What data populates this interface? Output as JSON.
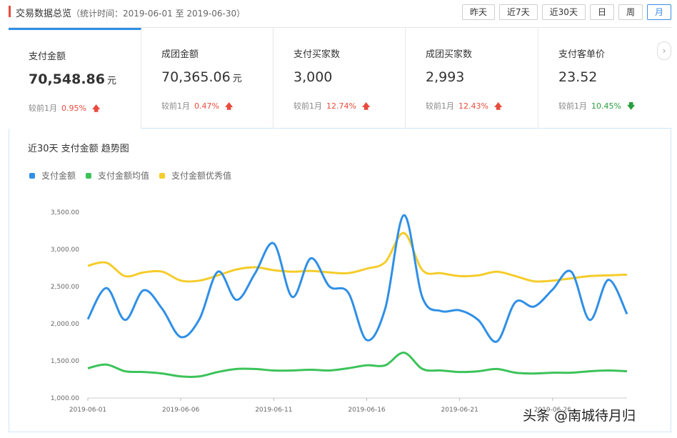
{
  "header": {
    "title": "交易数据总览",
    "subtitle": "（统计时间：2019-06-01 至 2019-06-30）",
    "ranges": [
      "昨天",
      "近7天",
      "近30天",
      "日",
      "周",
      "月"
    ],
    "active_range": "月"
  },
  "metrics": [
    {
      "label": "支付金额",
      "value": "70,548.86",
      "unit": "元",
      "cmp_label": "较前1月",
      "pct": "0.95%",
      "dir": "up"
    },
    {
      "label": "成团金额",
      "value": "70,365.06",
      "unit": "元",
      "cmp_label": "较前1月",
      "pct": "0.47%",
      "dir": "up"
    },
    {
      "label": "支付买家数",
      "value": "3,000",
      "unit": "",
      "cmp_label": "较前1月",
      "pct": "12.74%",
      "dir": "up"
    },
    {
      "label": "成团买家数",
      "value": "2,993",
      "unit": "",
      "cmp_label": "较前1月",
      "pct": "12.43%",
      "dir": "up"
    },
    {
      "label": "支付客单价",
      "value": "23.52",
      "unit": "",
      "cmp_label": "较前1月",
      "pct": "10.45%",
      "dir": "down"
    }
  ],
  "arrows": {
    "up": "🡅",
    "down": "🡇"
  },
  "next_icon": "›",
  "chart_title": "近30天 支付金额 趋势图",
  "watermark": "头条 @南城待月归",
  "colors": {
    "blue": "#2f8fe6",
    "green": "#3cc35a",
    "yellow": "#f5cc2a",
    "accent": "#e84c3d"
  },
  "chart_data": {
    "type": "line",
    "title": "近30天 支付金额 趋势图",
    "legend_position": "top-left",
    "grid": false,
    "ylim": [
      1000,
      3500
    ],
    "y_ticks": [
      "1,000.00",
      "1,500.00",
      "2,000.00",
      "2,500.00",
      "3,000.00",
      "3,500.00"
    ],
    "y_tick_values": [
      1000,
      1500,
      2000,
      2500,
      3000,
      3500
    ],
    "x_tick_labels": [
      "2019-06-01",
      "2019-06-06",
      "2019-06-11",
      "2019-06-16",
      "2019-06-21",
      "2019-06-26"
    ],
    "x": [
      "2019-06-01",
      "2019-06-02",
      "2019-06-03",
      "2019-06-04",
      "2019-06-05",
      "2019-06-06",
      "2019-06-07",
      "2019-06-08",
      "2019-06-09",
      "2019-06-10",
      "2019-06-11",
      "2019-06-12",
      "2019-06-13",
      "2019-06-14",
      "2019-06-15",
      "2019-06-16",
      "2019-06-17",
      "2019-06-18",
      "2019-06-19",
      "2019-06-20",
      "2019-06-21",
      "2019-06-22",
      "2019-06-23",
      "2019-06-24",
      "2019-06-25",
      "2019-06-26",
      "2019-06-27",
      "2019-06-28",
      "2019-06-29",
      "2019-06-30"
    ],
    "series": [
      {
        "name": "支付金额",
        "color": "#2f8fe6",
        "values": [
          2060,
          2480,
          2050,
          2450,
          2200,
          1820,
          2060,
          2700,
          2320,
          2680,
          3080,
          2360,
          2880,
          2500,
          2420,
          1780,
          2210,
          3460,
          2350,
          2170,
          2180,
          2050,
          1760,
          2290,
          2230,
          2460,
          2700,
          2050,
          2590,
          2130
        ]
      },
      {
        "name": "支付金额均值",
        "color": "#3cc35a",
        "values": [
          1400,
          1450,
          1360,
          1350,
          1330,
          1290,
          1290,
          1350,
          1390,
          1390,
          1370,
          1370,
          1380,
          1370,
          1400,
          1440,
          1440,
          1610,
          1390,
          1370,
          1350,
          1360,
          1390,
          1340,
          1330,
          1340,
          1340,
          1360,
          1370,
          1360
        ]
      },
      {
        "name": "支付金额优秀值",
        "color": "#f5cc2a",
        "values": [
          2780,
          2820,
          2640,
          2690,
          2700,
          2580,
          2580,
          2650,
          2730,
          2760,
          2720,
          2700,
          2710,
          2690,
          2680,
          2740,
          2830,
          3220,
          2720,
          2680,
          2640,
          2650,
          2700,
          2640,
          2570,
          2580,
          2610,
          2640,
          2650,
          2660
        ]
      }
    ]
  }
}
